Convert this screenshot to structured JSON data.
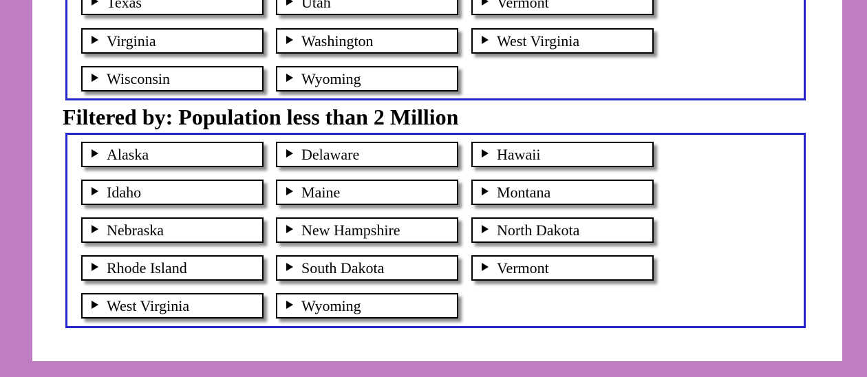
{
  "top_group": {
    "rows": [
      [
        "Texas",
        "Utah",
        "Vermont"
      ],
      [
        "Virginia",
        "Washington",
        "West Virginia"
      ],
      [
        "Wisconsin",
        "Wyoming"
      ]
    ]
  },
  "filter_heading": "Filtered by: Population less than 2 Million",
  "filtered_group": {
    "rows": [
      [
        "Alaska",
        "Delaware",
        "Hawaii"
      ],
      [
        "Idaho",
        "Maine",
        "Montana"
      ],
      [
        "Nebraska",
        "New Hampshire",
        "North Dakota"
      ],
      [
        "Rhode Island",
        "South Dakota",
        "Vermont"
      ],
      [
        "West Virginia",
        "Wyoming"
      ]
    ]
  },
  "icons": {
    "expand": "disclosure-triangle-icon"
  },
  "colors": {
    "background": "#bf7ec4",
    "group_border": "#2424c8"
  }
}
